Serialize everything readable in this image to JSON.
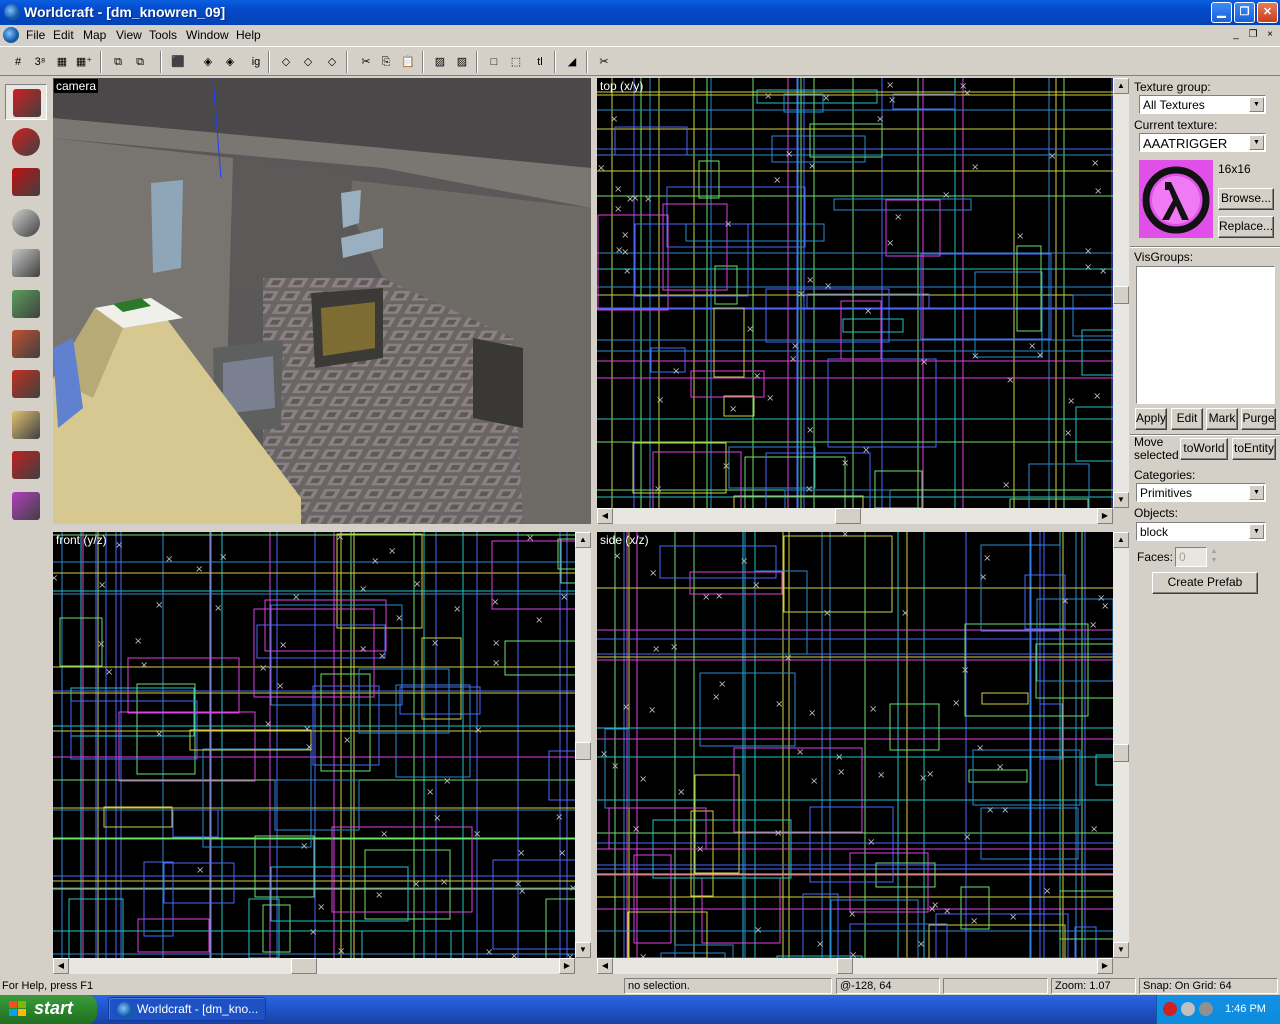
{
  "window": {
    "title": "Worldcraft - [dm_knowren_09]",
    "min": "0",
    "max": "1",
    "close": "r"
  },
  "menu": {
    "items": [
      "File",
      "Edit",
      "Map",
      "View",
      "Tools",
      "Window",
      "Help"
    ],
    "mdi_min": "_",
    "mdi_restore": "❐",
    "mdi_close": "×"
  },
  "toolbar": {
    "buttons": [
      "#",
      "3⁸",
      "▦",
      "▦⁺",
      "⧉",
      "⧉",
      "⬛",
      "◈",
      "◈",
      "ig",
      "◇",
      "◇",
      "◇",
      "✂",
      "⎘",
      "📋",
      "▨",
      "▨",
      "□",
      "⬚",
      "tl",
      "◢",
      "✂"
    ]
  },
  "tools": [
    "selection-tool",
    "magnify-tool",
    "camera-tool",
    "entity-tool",
    "block-tool",
    "texture-application-tool",
    "apply-current-texture-tool",
    "decal-tool",
    "clipping-tool",
    "vertex-manipulation-tool",
    "path-tool"
  ],
  "views": {
    "camera": {
      "label": "camera"
    },
    "top": {
      "label": "top (x/y)"
    },
    "front": {
      "label": "front (y/z)"
    },
    "side": {
      "label": "side (x/z)"
    }
  },
  "panel": {
    "texture_group_label": "Texture group:",
    "texture_group_value": "All Textures",
    "current_texture_label": "Current texture:",
    "current_texture_value": "AAATRIGGER",
    "texture_size": "16x16",
    "browse": "Browse...",
    "replace": "Replace...",
    "visgroups_label": "VisGroups:",
    "apply": "Apply",
    "edit": "Edit",
    "mark": "Mark",
    "purge": "Purge",
    "move_selected_label": "Move\nselected:",
    "to_world": "toWorld",
    "to_entity": "toEntity",
    "categories_label": "Categories:",
    "categories_value": "Primitives",
    "objects_label": "Objects:",
    "objects_value": "block",
    "faces_label": "Faces:",
    "faces_value": "0",
    "create_prefab": "Create Prefab"
  },
  "status": {
    "help": "For Help, press F1",
    "selection": "no selection.",
    "coords": "@-128, 64",
    "zoom": "Zoom: 1.07",
    "snap": "Snap: On Grid: 64"
  },
  "taskbar": {
    "start": "start",
    "task": "Worldcraft - [dm_kno...",
    "clock": "1:46 PM"
  },
  "colors": {
    "titlebar": "#0449c9",
    "grid_cyan": "#22c3c3",
    "grid_green": "#6ee06e",
    "grid_blue": "#4d68ff",
    "grid_magenta": "#e040e0",
    "texture_bg": "#e050e8"
  }
}
